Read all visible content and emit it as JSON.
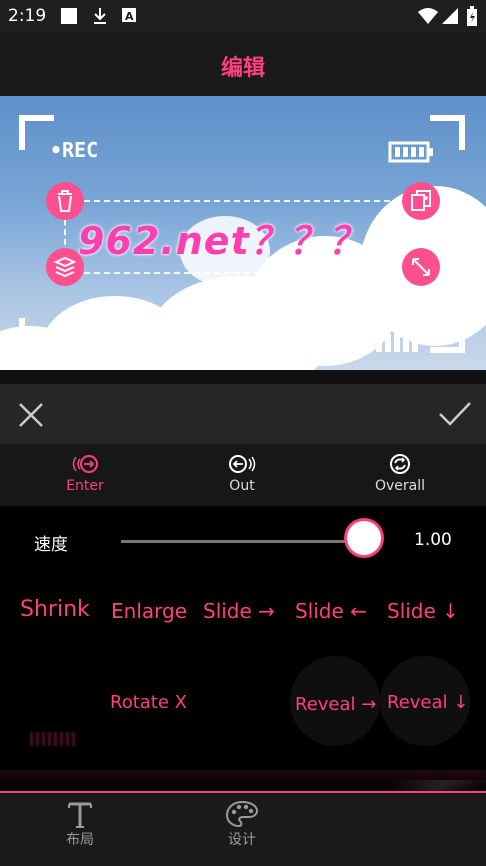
{
  "status_bar": {
    "time": "2:19"
  },
  "app_bar": {
    "title": "编辑"
  },
  "preview": {
    "rec_label": "•REC",
    "text_content": "962.net？？？"
  },
  "tabs": [
    {
      "label": "Enter",
      "active": true
    },
    {
      "label": "Out",
      "active": false
    },
    {
      "label": "Overall",
      "active": false
    }
  ],
  "speed": {
    "label": "速度",
    "value": "1.00",
    "level": 1.0
  },
  "effects": {
    "row1": [
      "Shrink",
      "Enlarge",
      "Slide →",
      "Slide ←",
      "Slide ↓"
    ],
    "row2": [
      "Rotate X",
      "Reveal →",
      "Reveal ↓"
    ]
  },
  "bottom_nav": [
    {
      "label": "布局",
      "icon": "text-icon"
    },
    {
      "label": "设计",
      "icon": "palette-icon"
    }
  ],
  "colors": {
    "accent": "#ff3f7f",
    "background": "#000000",
    "bar": "#1a1a1a"
  }
}
